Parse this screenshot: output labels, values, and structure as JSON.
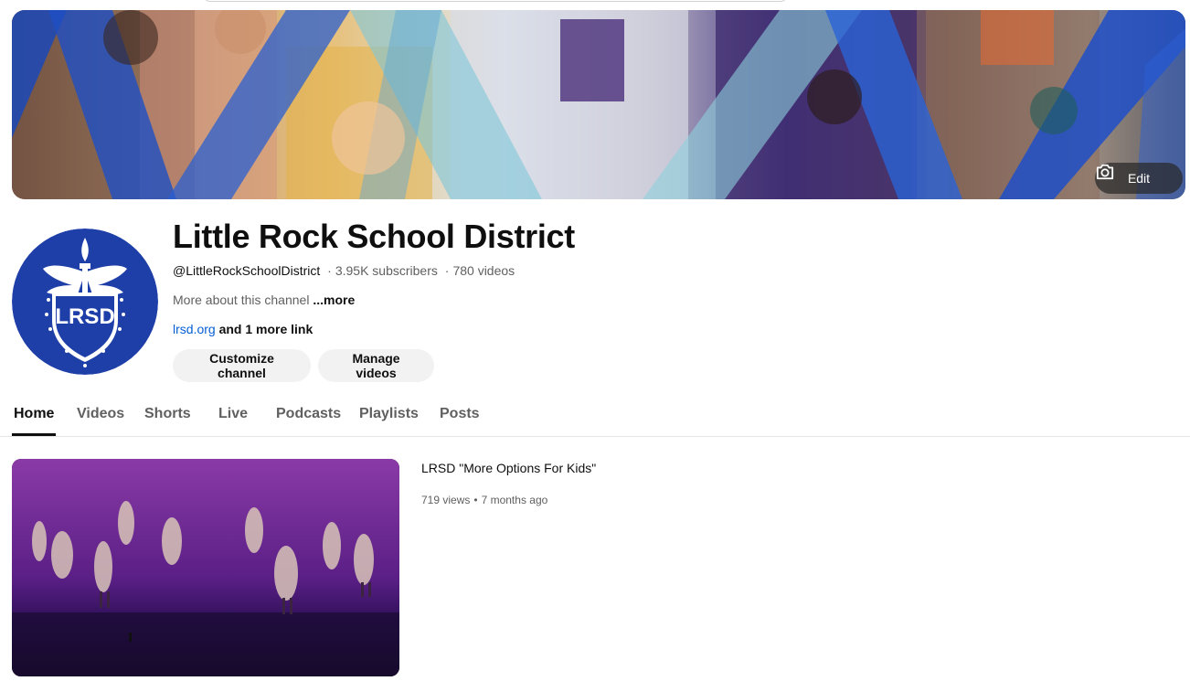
{
  "banner": {
    "edit_label": "Edit"
  },
  "channel": {
    "avatar_text": "LRSD",
    "title": "Little Rock School District",
    "handle": "@LittleRockSchoolDistrict",
    "subscribers": "3.95K subscribers",
    "videos_count": "780 videos",
    "about_text": "More about this channel",
    "about_more": "...more",
    "link": "lrsd.org",
    "more_links": "and 1 more link",
    "customize_label": "Customize channel",
    "manage_label": "Manage videos"
  },
  "tabs": [
    {
      "label": "Home",
      "active": true
    },
    {
      "label": "Videos"
    },
    {
      "label": "Shorts"
    },
    {
      "label": "Live"
    },
    {
      "label": "Podcasts"
    },
    {
      "label": "Playlists"
    },
    {
      "label": "Posts"
    }
  ],
  "featured_video": {
    "title": "LRSD \"More Options For Kids\"",
    "views": "719 views",
    "age": "7 months ago"
  },
  "colors": {
    "avatar_blue": "#1e3ea8",
    "link_blue": "#065fd4",
    "pill_bg": "#f2f2f2"
  }
}
